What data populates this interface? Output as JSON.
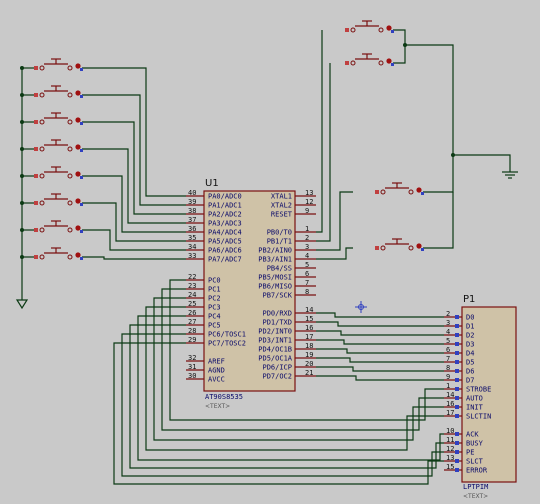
{
  "u1": {
    "ref": "U1",
    "part": "AT90S8535",
    "text_tag": "<TEXT>",
    "left_pins": [
      {
        "num": "40",
        "name": "PA0/ADC0"
      },
      {
        "num": "39",
        "name": "PA1/ADC1"
      },
      {
        "num": "38",
        "name": "PA2/ADC2"
      },
      {
        "num": "37",
        "name": "PA3/ADC3"
      },
      {
        "num": "36",
        "name": "PA4/ADC4"
      },
      {
        "num": "35",
        "name": "PA5/ADC5"
      },
      {
        "num": "34",
        "name": "PA6/ADC6"
      },
      {
        "num": "33",
        "name": "PA7/ADC7"
      },
      {
        "num": "22",
        "name": "PC0"
      },
      {
        "num": "23",
        "name": "PC1"
      },
      {
        "num": "24",
        "name": "PC2"
      },
      {
        "num": "25",
        "name": "PC3"
      },
      {
        "num": "26",
        "name": "PC4"
      },
      {
        "num": "27",
        "name": "PC5"
      },
      {
        "num": "28",
        "name": "PC6/TOSC1"
      },
      {
        "num": "29",
        "name": "PC7/TOSC2"
      },
      {
        "num": "32",
        "name": "AREF"
      },
      {
        "num": "31",
        "name": "AGND"
      },
      {
        "num": "30",
        "name": "AVCC"
      }
    ],
    "right_pins": [
      {
        "num": "13",
        "name": "XTAL1"
      },
      {
        "num": "12",
        "name": "XTAL2"
      },
      {
        "num": "9",
        "name": "RESET"
      },
      {
        "num": "1",
        "name": "PB0/T0"
      },
      {
        "num": "2",
        "name": "PB1/T1"
      },
      {
        "num": "3",
        "name": "PB2/AIN0"
      },
      {
        "num": "4",
        "name": "PB3/AIN1"
      },
      {
        "num": "5",
        "name": "PB4/SS"
      },
      {
        "num": "6",
        "name": "PB5/MOSI"
      },
      {
        "num": "7",
        "name": "PB6/MISO"
      },
      {
        "num": "8",
        "name": "PB7/SCK"
      },
      {
        "num": "14",
        "name": "PD0/RXD"
      },
      {
        "num": "15",
        "name": "PD1/TXD"
      },
      {
        "num": "16",
        "name": "PD2/INT0"
      },
      {
        "num": "17",
        "name": "PD3/INT1"
      },
      {
        "num": "18",
        "name": "PD4/OC1B"
      },
      {
        "num": "19",
        "name": "PD5/OC1A"
      },
      {
        "num": "20",
        "name": "PD6/ICP"
      },
      {
        "num": "21",
        "name": "PD7/OC2"
      }
    ]
  },
  "p1": {
    "ref": "P1",
    "part": "LPTPIM",
    "text_tag": "<TEXT>",
    "pins": [
      {
        "num": "2",
        "name": "D0"
      },
      {
        "num": "3",
        "name": "D1"
      },
      {
        "num": "4",
        "name": "D2"
      },
      {
        "num": "5",
        "name": "D3"
      },
      {
        "num": "6",
        "name": "D4"
      },
      {
        "num": "7",
        "name": "D5"
      },
      {
        "num": "8",
        "name": "D6"
      },
      {
        "num": "9",
        "name": "D7"
      },
      {
        "num": "1",
        "name": "STROBE"
      },
      {
        "num": "14",
        "name": "AUTO"
      },
      {
        "num": "16",
        "name": "INIT"
      },
      {
        "num": "17",
        "name": "SLCTIN"
      },
      {
        "num": "10",
        "name": "ACK"
      },
      {
        "num": "11",
        "name": "BUSY"
      },
      {
        "num": "12",
        "name": "PE"
      },
      {
        "num": "13",
        "name": "SLCT"
      },
      {
        "num": "15",
        "name": "ERROR"
      }
    ]
  },
  "switch_count_left": 8,
  "switch_count_top": 2,
  "switch_count_mid": 2,
  "colors": {
    "wire": "#0c3a14",
    "component": "#7a1010",
    "chip_fill": "#cfc2a7",
    "label": "#0a0a6a",
    "background": "#c9c9c9"
  }
}
